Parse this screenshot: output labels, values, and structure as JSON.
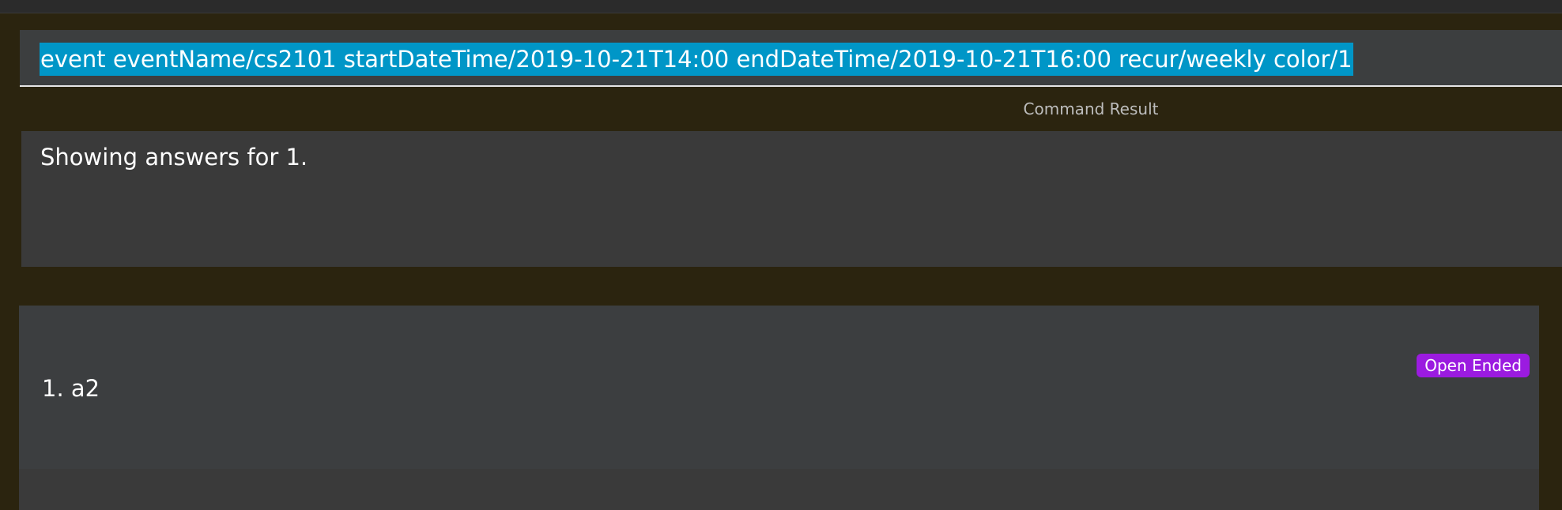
{
  "command_box": {
    "value": "event eventName/cs2101 startDateTime/2019-10-21T14:00 endDateTime/2019-10-21T16:00 recur/weekly color/1"
  },
  "result": {
    "label": "Command Result",
    "text": "Showing answers for 1."
  },
  "answer_list": {
    "items": [
      {
        "text": "1.  a2",
        "badge": "Open Ended"
      }
    ]
  },
  "colors": {
    "selection": "#0096c7",
    "badge": "#9b1be0",
    "background": "#2b240f"
  }
}
